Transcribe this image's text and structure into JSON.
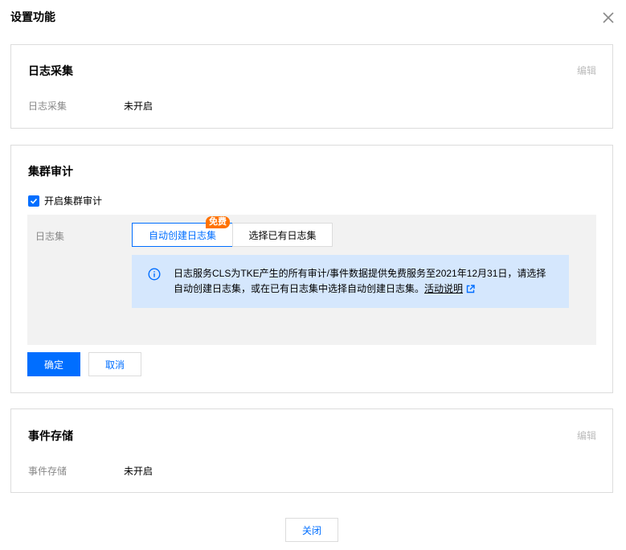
{
  "dialog": {
    "title": "设置功能",
    "close_label": "关闭"
  },
  "log_collection": {
    "title": "日志采集",
    "edit": "编辑",
    "field_label": "日志采集",
    "field_value": "未开启"
  },
  "cluster_audit": {
    "title": "集群审计",
    "checkbox_label": "开启集群审计",
    "checked": true,
    "log_set_label": "日志集",
    "options": [
      "自动创建日志集",
      "选择已有日志集"
    ],
    "selected_option": "自动创建日志集",
    "badge": "免费",
    "info_text": "日志服务CLS为TKE产生的所有审计/事件数据提供免费服务至2021年12月31日，请选择自动创建日志集，或在已有日志集中选择自动创建日志集。",
    "info_link": "活动说明",
    "confirm": "确定",
    "cancel": "取消"
  },
  "event_storage": {
    "title": "事件存储",
    "edit": "编辑",
    "field_label": "事件存储",
    "field_value": "未开启"
  },
  "colors": {
    "primary": "#006eff",
    "badge": "#ff7200",
    "info_bg": "#d5e7fd"
  }
}
